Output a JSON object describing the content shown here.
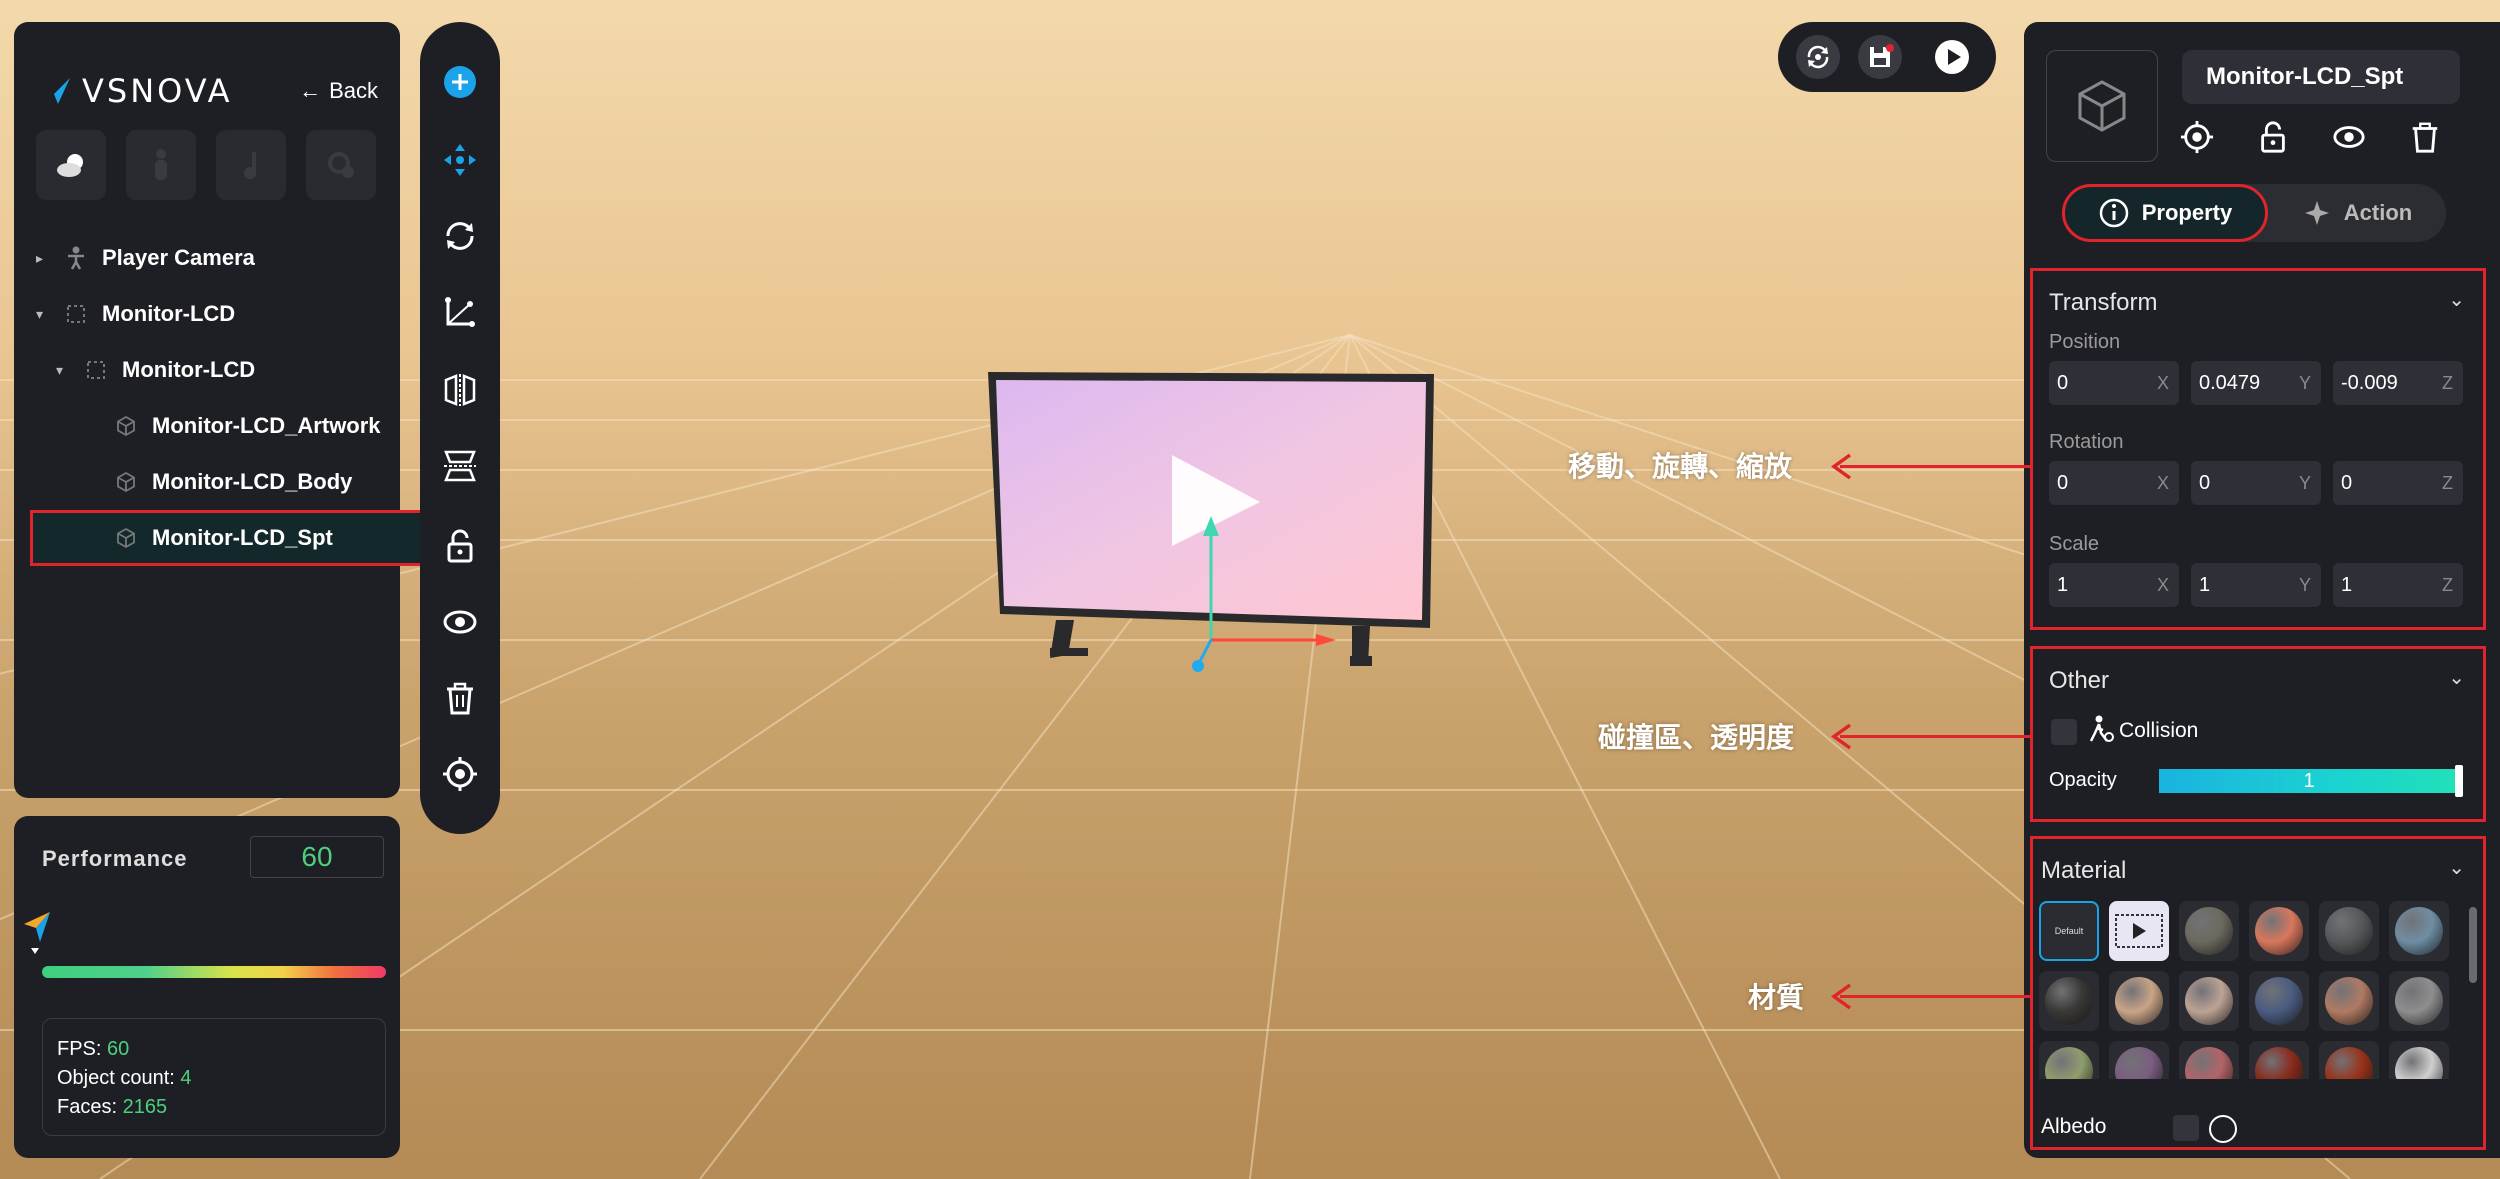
{
  "app": {
    "brand": "VSNOVA",
    "back_label": "Back"
  },
  "scene_tree": [
    {
      "label": "Player Camera",
      "level": 0,
      "expand": "▸",
      "icon": "person-icon"
    },
    {
      "label": "Monitor-LCD",
      "level": 0,
      "expand": "▾",
      "icon": "group-icon"
    },
    {
      "label": "Monitor-LCD",
      "level": 1,
      "expand": "▾",
      "icon": "group-icon"
    },
    {
      "label": "Monitor-LCD_Artwork",
      "level": 2,
      "expand": "",
      "icon": "cube-icon"
    },
    {
      "label": "Monitor-LCD_Body",
      "level": 2,
      "expand": "",
      "icon": "cube-icon"
    },
    {
      "label": "Monitor-LCD_Spt",
      "level": 2,
      "expand": "",
      "icon": "cube-icon",
      "selected": true
    }
  ],
  "performance": {
    "title": "Performance",
    "value": "60",
    "fps_label": "FPS:",
    "fps": "60",
    "objects_label": "Object count:",
    "objects": "4",
    "faces_label": "Faces:",
    "faces": "2165"
  },
  "toolbar": [
    "add-icon",
    "move-icon",
    "rotate-icon",
    "scale-axis-icon",
    "mirror-icon",
    "flip-vertical-icon",
    "unlock-icon",
    "eye-icon",
    "trash-icon",
    "target-icon"
  ],
  "top_controls": [
    "refresh-icon",
    "save-icon",
    "play-icon"
  ],
  "inspector": {
    "object_name": "Monitor-LCD_Spt",
    "tabs": {
      "property": "Property",
      "action": "Action"
    },
    "transform": {
      "title": "Transform",
      "position_label": "Position",
      "position": [
        "0",
        "0.0479",
        "-0.009"
      ],
      "rotation_label": "Rotation",
      "rotation": [
        "0",
        "0",
        "0"
      ],
      "scale_label": "Scale",
      "scale": [
        "1",
        "1",
        "1"
      ],
      "axes": [
        "X",
        "Y",
        "Z"
      ]
    },
    "other": {
      "title": "Other",
      "collision_label": "Collision",
      "opacity_label": "Opacity",
      "opacity_value": "1"
    },
    "material": {
      "title": "Material",
      "default_label": "Default",
      "albedo_label": "Albedo",
      "swatches": [
        "#6b6a5e",
        "#d9775e",
        "#55585a",
        "#6f8ea3",
        "#3a3835",
        "#c9a487",
        "#bca394",
        "#4a5c80",
        "#b07a63",
        "#8e8e8e",
        "#8f9d6c",
        "#7a5d80",
        "#b36468",
        "#8a2a1c",
        "#9a3218",
        "#cfcfcf"
      ]
    }
  },
  "annotations": {
    "transform": "移動、旋轉、縮放",
    "other": "碰撞區、透明度",
    "material": "材質"
  },
  "colors": {
    "highlight": "#e0242b",
    "accent": "#19b3e0",
    "success": "#4cd07d",
    "panel": "#1e1f24"
  }
}
